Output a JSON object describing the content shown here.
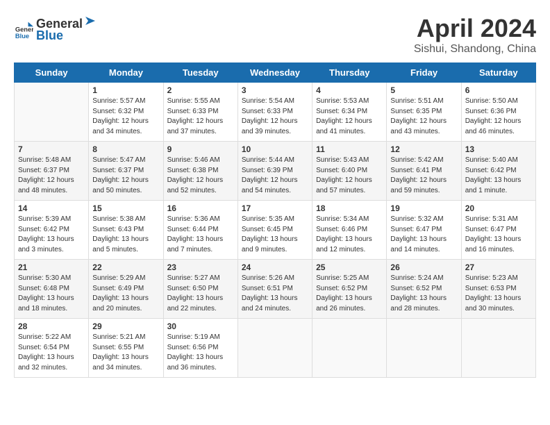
{
  "header": {
    "logo_general": "General",
    "logo_blue": "Blue",
    "title": "April 2024",
    "subtitle": "Sishui, Shandong, China"
  },
  "calendar": {
    "days_of_week": [
      "Sunday",
      "Monday",
      "Tuesday",
      "Wednesday",
      "Thursday",
      "Friday",
      "Saturday"
    ],
    "weeks": [
      [
        {
          "day": "",
          "info": ""
        },
        {
          "day": "1",
          "info": "Sunrise: 5:57 AM\nSunset: 6:32 PM\nDaylight: 12 hours\nand 34 minutes."
        },
        {
          "day": "2",
          "info": "Sunrise: 5:55 AM\nSunset: 6:33 PM\nDaylight: 12 hours\nand 37 minutes."
        },
        {
          "day": "3",
          "info": "Sunrise: 5:54 AM\nSunset: 6:33 PM\nDaylight: 12 hours\nand 39 minutes."
        },
        {
          "day": "4",
          "info": "Sunrise: 5:53 AM\nSunset: 6:34 PM\nDaylight: 12 hours\nand 41 minutes."
        },
        {
          "day": "5",
          "info": "Sunrise: 5:51 AM\nSunset: 6:35 PM\nDaylight: 12 hours\nand 43 minutes."
        },
        {
          "day": "6",
          "info": "Sunrise: 5:50 AM\nSunset: 6:36 PM\nDaylight: 12 hours\nand 46 minutes."
        }
      ],
      [
        {
          "day": "7",
          "info": "Sunrise: 5:48 AM\nSunset: 6:37 PM\nDaylight: 12 hours\nand 48 minutes."
        },
        {
          "day": "8",
          "info": "Sunrise: 5:47 AM\nSunset: 6:37 PM\nDaylight: 12 hours\nand 50 minutes."
        },
        {
          "day": "9",
          "info": "Sunrise: 5:46 AM\nSunset: 6:38 PM\nDaylight: 12 hours\nand 52 minutes."
        },
        {
          "day": "10",
          "info": "Sunrise: 5:44 AM\nSunset: 6:39 PM\nDaylight: 12 hours\nand 54 minutes."
        },
        {
          "day": "11",
          "info": "Sunrise: 5:43 AM\nSunset: 6:40 PM\nDaylight: 12 hours\nand 57 minutes."
        },
        {
          "day": "12",
          "info": "Sunrise: 5:42 AM\nSunset: 6:41 PM\nDaylight: 12 hours\nand 59 minutes."
        },
        {
          "day": "13",
          "info": "Sunrise: 5:40 AM\nSunset: 6:42 PM\nDaylight: 13 hours\nand 1 minute."
        }
      ],
      [
        {
          "day": "14",
          "info": "Sunrise: 5:39 AM\nSunset: 6:42 PM\nDaylight: 13 hours\nand 3 minutes."
        },
        {
          "day": "15",
          "info": "Sunrise: 5:38 AM\nSunset: 6:43 PM\nDaylight: 13 hours\nand 5 minutes."
        },
        {
          "day": "16",
          "info": "Sunrise: 5:36 AM\nSunset: 6:44 PM\nDaylight: 13 hours\nand 7 minutes."
        },
        {
          "day": "17",
          "info": "Sunrise: 5:35 AM\nSunset: 6:45 PM\nDaylight: 13 hours\nand 9 minutes."
        },
        {
          "day": "18",
          "info": "Sunrise: 5:34 AM\nSunset: 6:46 PM\nDaylight: 13 hours\nand 12 minutes."
        },
        {
          "day": "19",
          "info": "Sunrise: 5:32 AM\nSunset: 6:47 PM\nDaylight: 13 hours\nand 14 minutes."
        },
        {
          "day": "20",
          "info": "Sunrise: 5:31 AM\nSunset: 6:47 PM\nDaylight: 13 hours\nand 16 minutes."
        }
      ],
      [
        {
          "day": "21",
          "info": "Sunrise: 5:30 AM\nSunset: 6:48 PM\nDaylight: 13 hours\nand 18 minutes."
        },
        {
          "day": "22",
          "info": "Sunrise: 5:29 AM\nSunset: 6:49 PM\nDaylight: 13 hours\nand 20 minutes."
        },
        {
          "day": "23",
          "info": "Sunrise: 5:27 AM\nSunset: 6:50 PM\nDaylight: 13 hours\nand 22 minutes."
        },
        {
          "day": "24",
          "info": "Sunrise: 5:26 AM\nSunset: 6:51 PM\nDaylight: 13 hours\nand 24 minutes."
        },
        {
          "day": "25",
          "info": "Sunrise: 5:25 AM\nSunset: 6:52 PM\nDaylight: 13 hours\nand 26 minutes."
        },
        {
          "day": "26",
          "info": "Sunrise: 5:24 AM\nSunset: 6:52 PM\nDaylight: 13 hours\nand 28 minutes."
        },
        {
          "day": "27",
          "info": "Sunrise: 5:23 AM\nSunset: 6:53 PM\nDaylight: 13 hours\nand 30 minutes."
        }
      ],
      [
        {
          "day": "28",
          "info": "Sunrise: 5:22 AM\nSunset: 6:54 PM\nDaylight: 13 hours\nand 32 minutes."
        },
        {
          "day": "29",
          "info": "Sunrise: 5:21 AM\nSunset: 6:55 PM\nDaylight: 13 hours\nand 34 minutes."
        },
        {
          "day": "30",
          "info": "Sunrise: 5:19 AM\nSunset: 6:56 PM\nDaylight: 13 hours\nand 36 minutes."
        },
        {
          "day": "",
          "info": ""
        },
        {
          "day": "",
          "info": ""
        },
        {
          "day": "",
          "info": ""
        },
        {
          "day": "",
          "info": ""
        }
      ]
    ]
  }
}
